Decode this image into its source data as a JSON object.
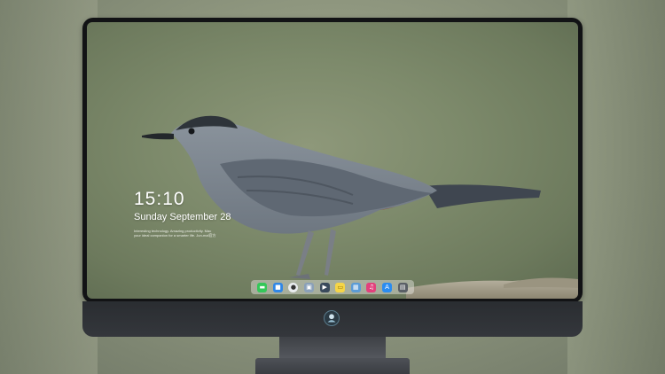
{
  "lockscreen": {
    "time": "15:10",
    "date": "Sunday September 28",
    "notice_line1": "Interesting technology. Amazing productivity. Mac",
    "notice_line2": "your ideal companion for a smarter life. Jun-mal官方"
  },
  "dock": {
    "items": [
      {
        "name": "messages",
        "glyph": "▬",
        "color": "#34c759"
      },
      {
        "name": "finder",
        "glyph": "■",
        "color": "#2f86e6"
      },
      {
        "name": "safari",
        "glyph": "●",
        "color": "#e9ecef"
      },
      {
        "name": "preview",
        "glyph": "▣",
        "color": "#8aa0b8"
      },
      {
        "name": "final-cut",
        "glyph": "▶",
        "color": "#3a4a5c"
      },
      {
        "name": "notes",
        "glyph": "▭",
        "color": "#f5d547"
      },
      {
        "name": "photos",
        "glyph": "▦",
        "color": "#5b9bd5"
      },
      {
        "name": "music",
        "glyph": "♫",
        "color": "#e2407c"
      },
      {
        "name": "app-store",
        "glyph": "A",
        "color": "#2a8cf0"
      },
      {
        "name": "camera",
        "glyph": "▤",
        "color": "#5a5f66"
      }
    ]
  },
  "colors": {
    "bezel": "#121315",
    "chin": "#2f3237",
    "bird_body": "#7d8791",
    "text": "#ffffff"
  }
}
